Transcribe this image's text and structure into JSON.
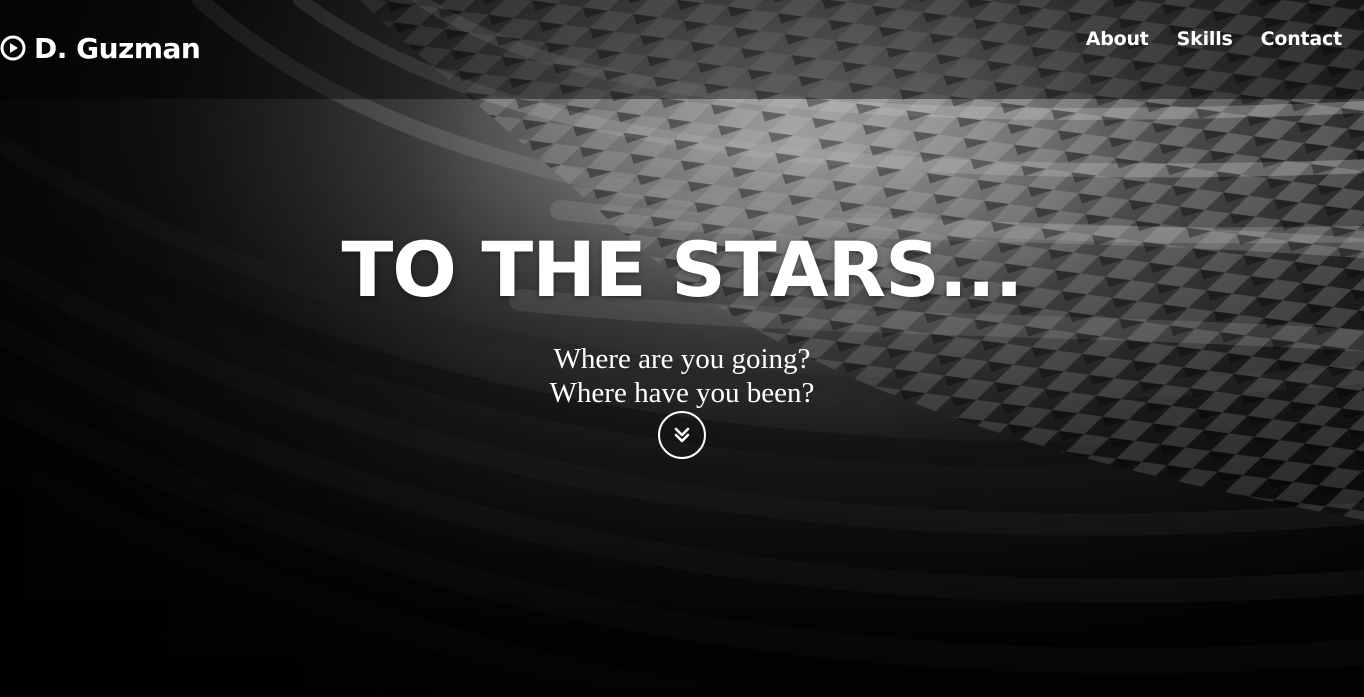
{
  "brand": {
    "icon": "play-circle-icon",
    "name": "D. Guzman"
  },
  "nav": {
    "items": [
      {
        "label": "About"
      },
      {
        "label": "Skills"
      },
      {
        "label": "Contact"
      }
    ]
  },
  "hero": {
    "title": "TO THE STARS...",
    "subtitle_line1": "Where are you going?",
    "subtitle_line2": "Where have you been?",
    "scroll_icon": "double-chevron-down-icon",
    "background": "black-and-white architectural lattice photograph"
  },
  "colors": {
    "text": "#ffffff",
    "navbar_overlay": "#000000"
  }
}
